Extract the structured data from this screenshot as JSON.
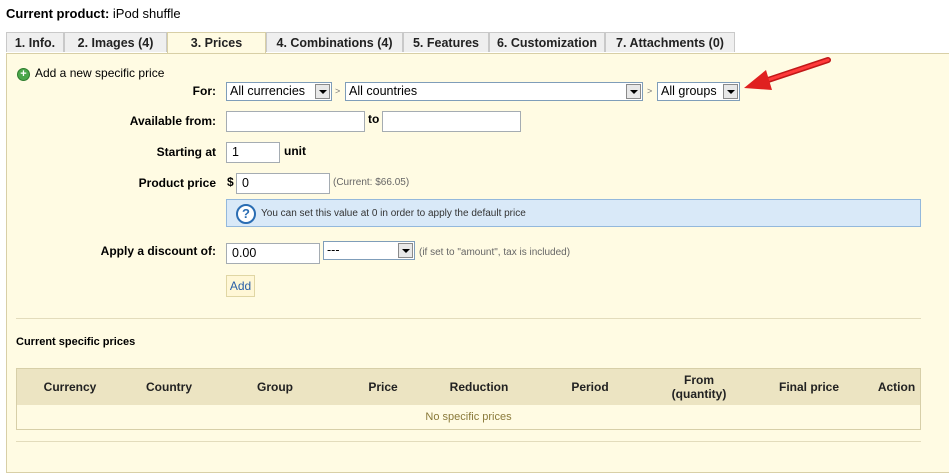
{
  "header": {
    "label": "Current product:",
    "product": "iPod shuffle"
  },
  "tabs": [
    {
      "label": "1. Info."
    },
    {
      "label": "2. Images (4)"
    },
    {
      "label": "3. Prices"
    },
    {
      "label": "4. Combinations (4)"
    },
    {
      "label": "5. Features"
    },
    {
      "label": "6. Customization"
    },
    {
      "label": "7. Attachments (0)"
    }
  ],
  "form": {
    "add_new": "Add a new specific price",
    "for_label": "For:",
    "currency": "All currencies",
    "country": "All countries",
    "group": "All groups",
    "available_label": "Available from:",
    "from_value": "",
    "to_label": "to",
    "to_value": "",
    "starting_label": "Starting at",
    "starting_value": "1",
    "unit_label": "unit",
    "price_label": "Product price",
    "currency_symbol": "$",
    "price_value": "0",
    "current_note": "(Current: $66.05)",
    "info_text": "You can set this value at 0 in order to apply the default price",
    "discount_label": "Apply a discount of:",
    "discount_value": "0.00",
    "discount_type": "---",
    "discount_note": "(if set to \"amount\", tax is included)",
    "add_button": "Add"
  },
  "specific_prices": {
    "title": "Current specific prices",
    "columns": [
      "Currency",
      "Country",
      "Group",
      "Price",
      "Reduction",
      "Period",
      "From\n(quantity)",
      "Final price",
      "Action"
    ],
    "empty": "No specific prices"
  },
  "colors": {
    "panel": "#fffbe3",
    "header_row": "#ece4c2",
    "info_bg": "#d9e9f8",
    "arrow": "#e02020"
  }
}
